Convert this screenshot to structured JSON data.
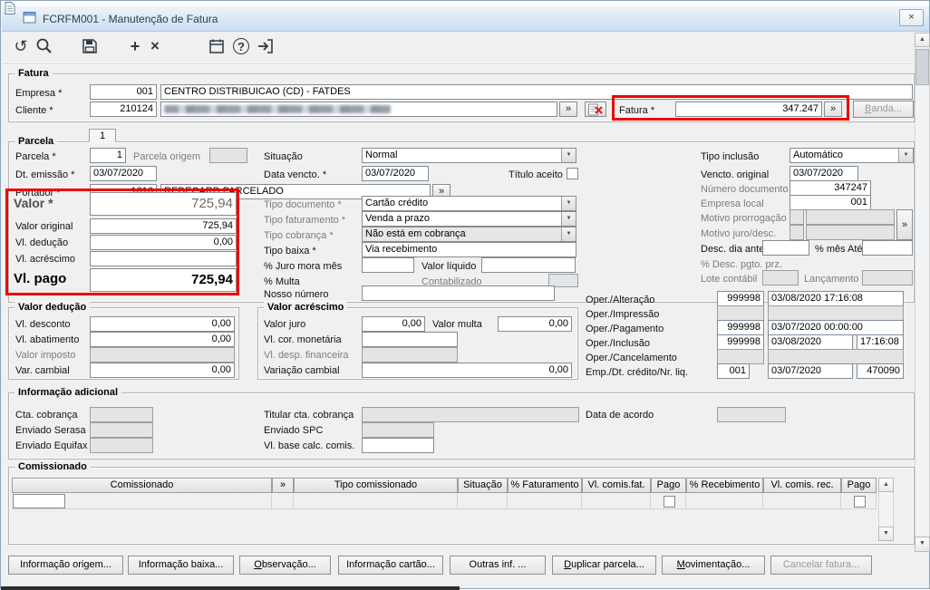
{
  "ui": {
    "close": "×",
    "more": "»",
    "down": "▼",
    "up": "▲",
    "plus": "+",
    "x": "×",
    "help": "?",
    "undo": "↺"
  },
  "window": {
    "title": "FCRFM001 - Manutenção de Fatura"
  },
  "fatura": {
    "group": "Fatura",
    "empresa_label": "Empresa *",
    "empresa_code": "001",
    "empresa_name": "CENTRO DISTRIBUICAO (CD) - FATDES",
    "cliente_label": "Cliente *",
    "cliente_code": "210124",
    "fatura_label": "Fatura *",
    "fatura_value": "347.247",
    "banda": "Banda..."
  },
  "parcela": {
    "group": "Parcela",
    "tab": "1",
    "parcela_label": "Parcela *",
    "parcela_value": "1",
    "origem_label": "Parcela origem",
    "dt_emissao_label": "Dt. emissão *",
    "dt_emissao": "03/07/2020",
    "portador_label": "Portador *",
    "portador_code": "1616",
    "portador_name": "REDECARD PARCELADO",
    "situacao_label": "Situação",
    "situacao": "Normal",
    "data_vencto_label": "Data vencto. *",
    "data_vencto": "03/07/2020",
    "titulo_aceito_label": "Título aceito",
    "tipo_inclusao_label": "Tipo inclusão",
    "tipo_inclusao": "Automático",
    "vencto_original_label": "Vencto. original",
    "vencto_original": "03/07/2020",
    "numero_documento_label": "Número documento",
    "numero_documento": "347247",
    "empresa_local_label": "Empresa local",
    "empresa_local": "001",
    "valor_label": "Valor *",
    "valor": "725,94",
    "valor_original_label": "Valor original",
    "valor_original": "725,94",
    "vl_deducao_label": "Vl. dedução",
    "vl_deducao": "0,00",
    "vl_acrescimo_label": "Vl. acréscimo",
    "vl_pago_label": "Vl. pago",
    "vl_pago": "725,94",
    "tipo_documento_label": "Tipo documento *",
    "tipo_documento": "Cartão crédito",
    "tipo_faturamento_label": "Tipo faturamento *",
    "tipo_faturamento": "Venda a prazo",
    "tipo_cobranca_label": "Tipo cobrança *",
    "tipo_cobranca": "Não está em cobrança",
    "tipo_baixa_label": "Tipo baixa *",
    "tipo_baixa": "Via recebimento",
    "juro_mora_label": "% Juro mora mês",
    "valor_liquido_label": "Valor líquido",
    "multa_label": "% Multa",
    "contabilizado_label": "Contabilizado",
    "nosso_numero_label": "Nosso número",
    "motivo_prorrogacao_label": "Motivo prorrogação",
    "motivo_juro_label": "Motivo juro/desc.",
    "desc_antecip_label": "Desc. dia antecip.",
    "pct_mes_label": "% mês",
    "ate_label": "Até",
    "desc_pgto_label": "% Desc. pgto. prz.",
    "lote_label": "Lote contábil",
    "lancamento_label": "Lançamento"
  },
  "oper": {
    "alteracao_label": "Oper./Alteração",
    "alteracao_oper": "999998",
    "alteracao_data": "03/08/2020 17:16:08",
    "impressao_label": "Oper./Impressão",
    "pagamento_label": "Oper./Pagamento",
    "pagamento_oper": "999998",
    "pagamento_data": "03/07/2020 00:00:00",
    "inclusao_label": "Oper./Inclusão",
    "inclusao_oper": "999998",
    "inclusao_data": "03/08/2020",
    "inclusao_hora": "17:16:08",
    "cancelamento_label": "Oper./Cancelamento",
    "credito_label": "Emp./Dt. crédito/Nr. liq.",
    "credito_emp": "001",
    "credito_data": "03/07/2020",
    "credito_nr": "470090"
  },
  "valor_deducao": {
    "group": "Valor dedução",
    "vl_desconto_label": "Vl. desconto",
    "vl_desconto": "0,00",
    "vl_abatimento_label": "Vl. abatimento",
    "vl_abatimento": "0,00",
    "valor_imposto_label": "Valor imposto",
    "var_cambial_label": "Var. cambial",
    "var_cambial": "0,00"
  },
  "valor_acrescimo": {
    "group": "Valor acréscimo",
    "valor_juro_label": "Valor juro",
    "valor_juro": "0,00",
    "valor_multa_label": "Valor multa",
    "valor_multa": "0,00",
    "vl_cor_label": "Vl. cor. monetária",
    "vl_desp_label": "Vl. desp. financeira",
    "variacao_label": "Variação cambial",
    "variacao": "0,00"
  },
  "info": {
    "group": "Informação adicional",
    "cta_label": "Cta. cobrança",
    "serasa_label": "Enviado Serasa",
    "equifax_label": "Enviado Equifax",
    "titular_label": "Titular cta. cobrança",
    "spc_label": "Enviado SPC",
    "base_label": "Vl. base calc. comis.",
    "acordo_label": "Data de acordo"
  },
  "grid": {
    "group": "Comissionado",
    "columns": [
      "Comissionado",
      "»",
      "Tipo comissionado",
      "Situação",
      "% Faturamento",
      "Vl. comis.fat.",
      "Pago",
      "% Recebimento",
      "Vl. comis. rec.",
      "Pago"
    ]
  },
  "buttons": {
    "origem": "Informação origem...",
    "baixa": "Informação baixa...",
    "observacao": "Observação...",
    "cartao": "Informação cartão...",
    "outras": "Outras inf. ...",
    "duplicar": "Duplicar parcela...",
    "movimentacao": "Movimentação...",
    "cancelar": "Cancelar fatura..."
  }
}
